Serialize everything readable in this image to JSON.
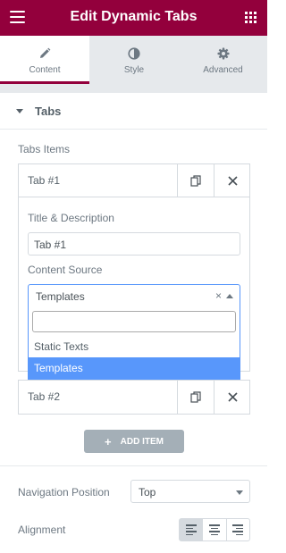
{
  "header": {
    "title": "Edit Dynamic Tabs",
    "menu_icon": "hamburger-icon",
    "apps_icon": "grid-icon"
  },
  "tabs": [
    {
      "label": "Content",
      "icon": "pencil-icon",
      "active": true
    },
    {
      "label": "Style",
      "icon": "half-circle-icon",
      "active": false
    },
    {
      "label": "Advanced",
      "icon": "gear-icon",
      "active": false
    }
  ],
  "section": {
    "title": "Tabs"
  },
  "repeater": {
    "label": "Tabs Items",
    "items": [
      {
        "title": "Tab #1",
        "expanded": true
      },
      {
        "title": "Tab #2",
        "expanded": false
      }
    ],
    "editor": {
      "title_label": "Title & Description",
      "title_value": "Tab #1",
      "source_label": "Content Source",
      "source_value": "Templates",
      "source_clear": "×",
      "search_value": "",
      "options": [
        "Static Texts",
        "Templates"
      ],
      "selected_option": "Templates"
    },
    "add_label": "ADD ITEM",
    "add_plus": "+"
  },
  "navigation": {
    "label": "Navigation Position",
    "value": "Top"
  },
  "alignment": {
    "label": "Alignment",
    "options": [
      "left",
      "center",
      "right"
    ],
    "selected": "left"
  },
  "colors": {
    "brand": "#93003c",
    "select_highlight": "#5897fb"
  }
}
